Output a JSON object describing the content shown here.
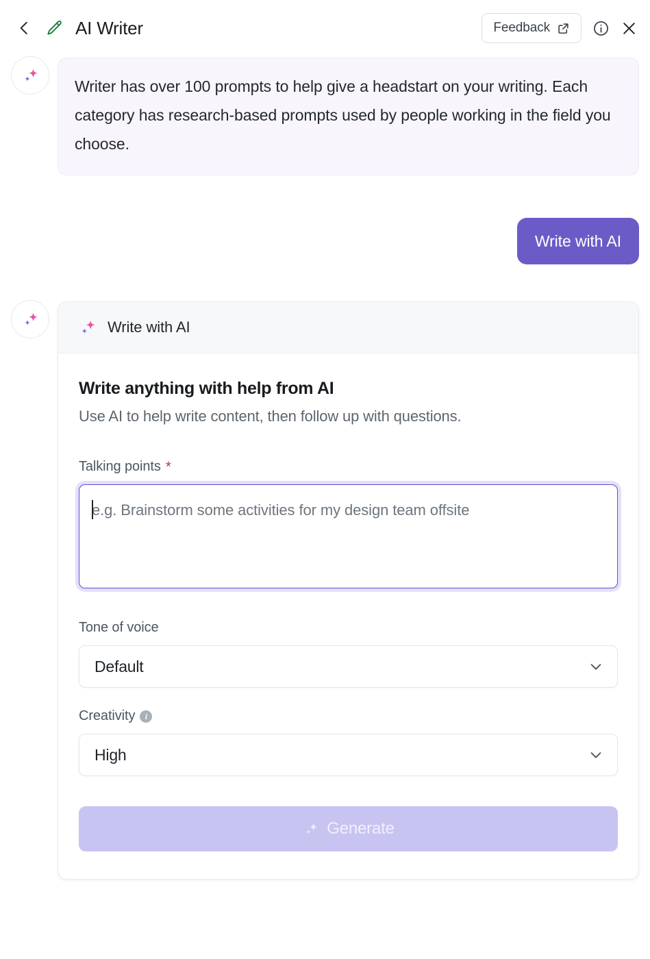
{
  "header": {
    "back_icon": "chevron-left-icon",
    "doc_icon": "pencil-icon",
    "title": "AI Writer",
    "feedback_label": "Feedback",
    "feedback_icon": "external-link-icon",
    "info_icon": "info-circle-icon",
    "close_icon": "close-x-icon",
    "accent_green": "#1f8043"
  },
  "conversation": {
    "ai_intro": {
      "avatar_icon": "sparkle-avatar-icon",
      "text": "Writer has over 100 prompts to help give a headstart on your writing. Each category has research-based prompts used by people working in the field you choose.",
      "bubble_color": "#f8f6fc"
    },
    "user_message": {
      "text": "Write with AI",
      "bubble_color": "#6b5bc7"
    }
  },
  "tool_card": {
    "avatar_icon": "sparkle-avatar-icon",
    "header": {
      "icon": "sparkle-icon",
      "title": "Write with AI"
    },
    "heading": "Write anything with help from AI",
    "subheading": "Use AI to help write content, then follow up with questions.",
    "talking_points": {
      "label": "Talking points",
      "required_mark": "*",
      "placeholder": "e.g. Brainstorm some activities for my design team offsite",
      "value": "",
      "focused": true,
      "focus_color": "#5b4fd6"
    },
    "tone_of_voice": {
      "label": "Tone of voice",
      "selected": "Default",
      "chevron_icon": "chevron-down-icon"
    },
    "creativity": {
      "label": "Creativity",
      "info_icon": "info-circle-icon",
      "info_glyph": "i",
      "selected": "High",
      "chevron_icon": "chevron-down-icon"
    },
    "generate": {
      "label": "Generate",
      "icon": "sparkle-icon",
      "disabled": true,
      "color": "#c8c4f2"
    }
  }
}
